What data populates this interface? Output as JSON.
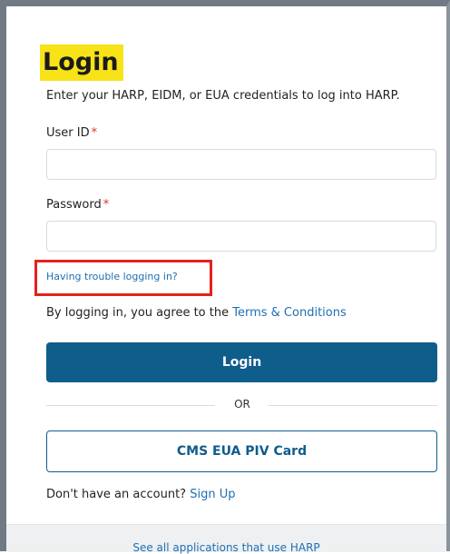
{
  "login": {
    "title": "Login",
    "intro": "Enter your HARP, EIDM, or EUA credentials to log into HARP.",
    "user_id": {
      "label": "User ID",
      "required_mark": "*",
      "value": "",
      "placeholder": ""
    },
    "password": {
      "label": "Password",
      "required_mark": "*",
      "value": "",
      "placeholder": ""
    },
    "trouble_link": "Having trouble logging in?",
    "agreement_text": "By logging in, you agree to the",
    "terms_link": "Terms & Conditions",
    "login_button": "Login",
    "divider_text": "OR",
    "piv_button": "CMS EUA PIV Card",
    "signup_text": "Don't have an account?",
    "signup_link": "Sign Up"
  },
  "footer": {
    "applications_link": "See all applications that use HARP"
  },
  "colors": {
    "title_highlight": "#f7e318",
    "primary_blue": "#0f5d8a",
    "link_blue": "#1f6fb2",
    "required_red": "#d9342b",
    "annotation_red": "#e2231a",
    "footer_bg": "#eef0f2"
  }
}
